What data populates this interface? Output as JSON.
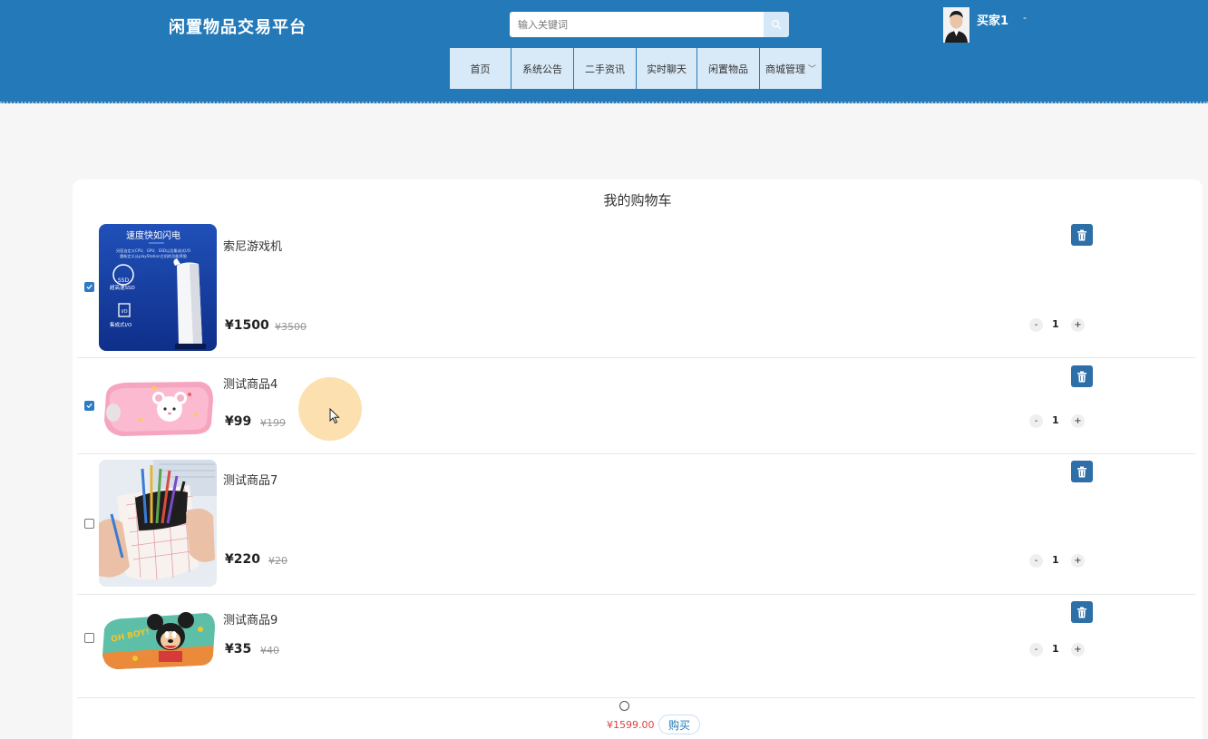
{
  "header": {
    "site_title": "闲置物品交易平台",
    "search_placeholder": "输入关键词",
    "username": "买家1",
    "user_caret": "-"
  },
  "nav": {
    "items": [
      {
        "label": "首页"
      },
      {
        "label": "系统公告"
      },
      {
        "label": "二手资讯"
      },
      {
        "label": "实时聊天"
      },
      {
        "label": "闲置物品"
      },
      {
        "label": "商城管理"
      }
    ]
  },
  "cart": {
    "title": "我的购物车",
    "items": [
      {
        "name": "索尼游戏机",
        "price": "¥1500",
        "original_price": "¥3500",
        "quantity": "1",
        "checked": true,
        "image": "ps5-console",
        "thumb_text": {
          "heading": "速度快如闪电",
          "lines": [
            "另搭自定义CPU、GPU、SSD以及集成式I/O",
            "重新定义从playStation主机的功能界限"
          ],
          "badge1": "SSD",
          "sub1": "超高速SSD",
          "badge2": "I/O",
          "sub2": "集成式I/O"
        }
      },
      {
        "name": "测试商品4",
        "price": "¥99",
        "original_price": "¥199",
        "quantity": "1",
        "checked": true,
        "image": "pink-mouse-pencil-case"
      },
      {
        "name": "测试商品7",
        "price": "¥220",
        "original_price": "¥20",
        "quantity": "1",
        "checked": false,
        "image": "grid-pencil-bag"
      },
      {
        "name": "测试商品9",
        "price": "¥35",
        "original_price": "¥40",
        "quantity": "1",
        "checked": false,
        "image": "mickey-pencil-box",
        "thumb_text": {
          "badge": "OH BOY!"
        }
      }
    ],
    "stepper": {
      "minus": "-",
      "plus": "+"
    },
    "total": "¥1599.00",
    "buy_label": "购买"
  },
  "colors": {
    "header_bg": "#2479b8",
    "nav_bg": "#d8eaf8",
    "checkbox_checked": "#2d7bc4",
    "delete_button": "#2e6fa8",
    "total_text": "#e43d3d"
  }
}
